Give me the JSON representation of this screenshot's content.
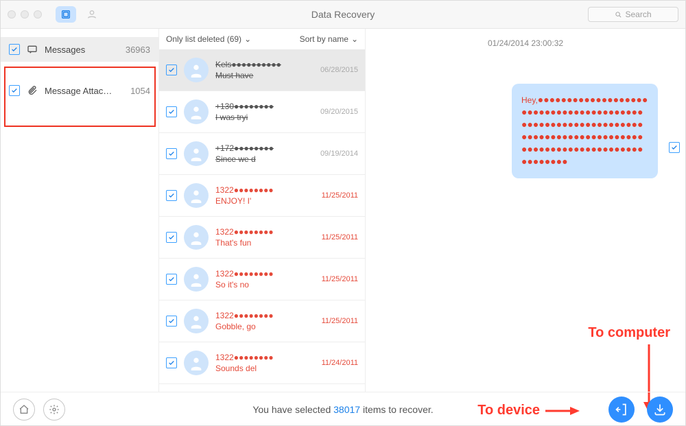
{
  "window_title": "Data Recovery",
  "search_placeholder": "Search",
  "sidebar": {
    "items": [
      {
        "label": "Messages",
        "count": "36963"
      },
      {
        "label": "Message Attac…",
        "count": "1054"
      }
    ]
  },
  "mid": {
    "filter_label": "Only list deleted (69)",
    "sort_label": "Sort by name",
    "chev": "⌄"
  },
  "rows": [
    {
      "title": "Kels●●●●●●●●●●",
      "sub": "Must have",
      "date": "06/28/2015",
      "deleted": true,
      "red": false,
      "sel": true
    },
    {
      "title": "+130●●●●●●●●",
      "sub": "I was tryi",
      "date": "09/20/2015",
      "deleted": true,
      "red": false,
      "sel": false
    },
    {
      "title": "+172●●●●●●●●",
      "sub": "Since we d",
      "date": "09/19/2014",
      "deleted": true,
      "red": false,
      "sel": false
    },
    {
      "title": "1322●●●●●●●●",
      "sub": "ENJOY!  I'",
      "date": "11/25/2011",
      "deleted": false,
      "red": true,
      "sel": false
    },
    {
      "title": "1322●●●●●●●●",
      "sub": "That's fun",
      "date": "11/25/2011",
      "deleted": false,
      "red": true,
      "sel": false
    },
    {
      "title": "1322●●●●●●●●",
      "sub": "So it's no",
      "date": "11/25/2011",
      "deleted": false,
      "red": true,
      "sel": false
    },
    {
      "title": "1322●●●●●●●●",
      "sub": "Gobble, go",
      "date": "11/25/2011",
      "deleted": false,
      "red": true,
      "sel": false
    },
    {
      "title": "1322●●●●●●●●",
      "sub": "Sounds del",
      "date": "11/24/2011",
      "deleted": false,
      "red": true,
      "sel": false
    }
  ],
  "conversation": {
    "timestamp": "01/24/2014 23:00:32",
    "bubble_prefix": "Hey,",
    "bubble_dots": "●●●●●●●●●●●●●●●●●●●●●●●●●●●●●●●●●●●●●●●●●●●●●●●●●●●●●●●●●●●●●●●●●●●●●●●●●●●●●●●●●●●●●●●●●●●●●●●●●●●●●●●●●●●●●●●"
  },
  "footer": {
    "pre": "You have selected ",
    "count": "38017",
    "post": " items to recover."
  },
  "annotations": {
    "to_computer": "To computer",
    "to_device": "To device"
  },
  "colors": {
    "accent": "#1b80e8",
    "danger": "#e53f2e"
  }
}
